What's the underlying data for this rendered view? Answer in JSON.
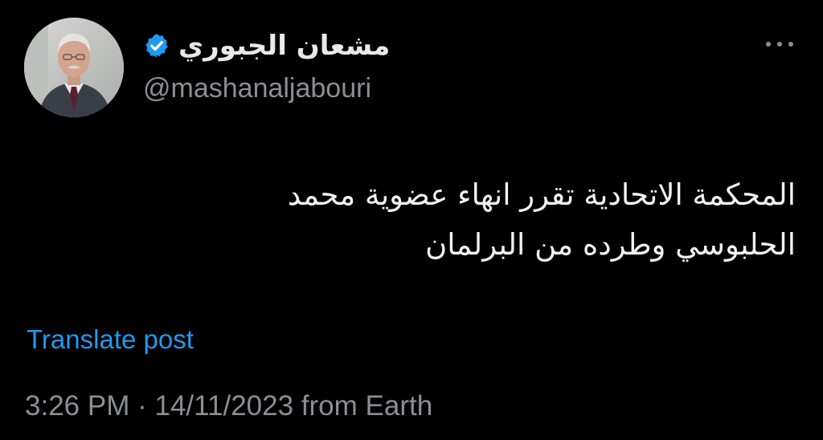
{
  "author": {
    "display_name": "مشعان الجبوري",
    "handle": "@mashanaljabouri",
    "verified": true
  },
  "icons": {
    "more": "more-horizontal-icon",
    "verified": "verified-badge-icon"
  },
  "colors": {
    "background": "#000000",
    "text": "#e7e9ea",
    "secondary_text": "#8b8f94",
    "link": "#1d9bf0",
    "verified_badge": "#1d9bf0"
  },
  "post": {
    "text": "المحكمة الاتحادية تقرر انهاء عضوية محمد الحلبوسي وطرده من البرلمان",
    "translate_label": "Translate post"
  },
  "meta": {
    "time": "3:26 PM",
    "separator": "·",
    "date": "14/11/2023",
    "source": "from Earth"
  }
}
